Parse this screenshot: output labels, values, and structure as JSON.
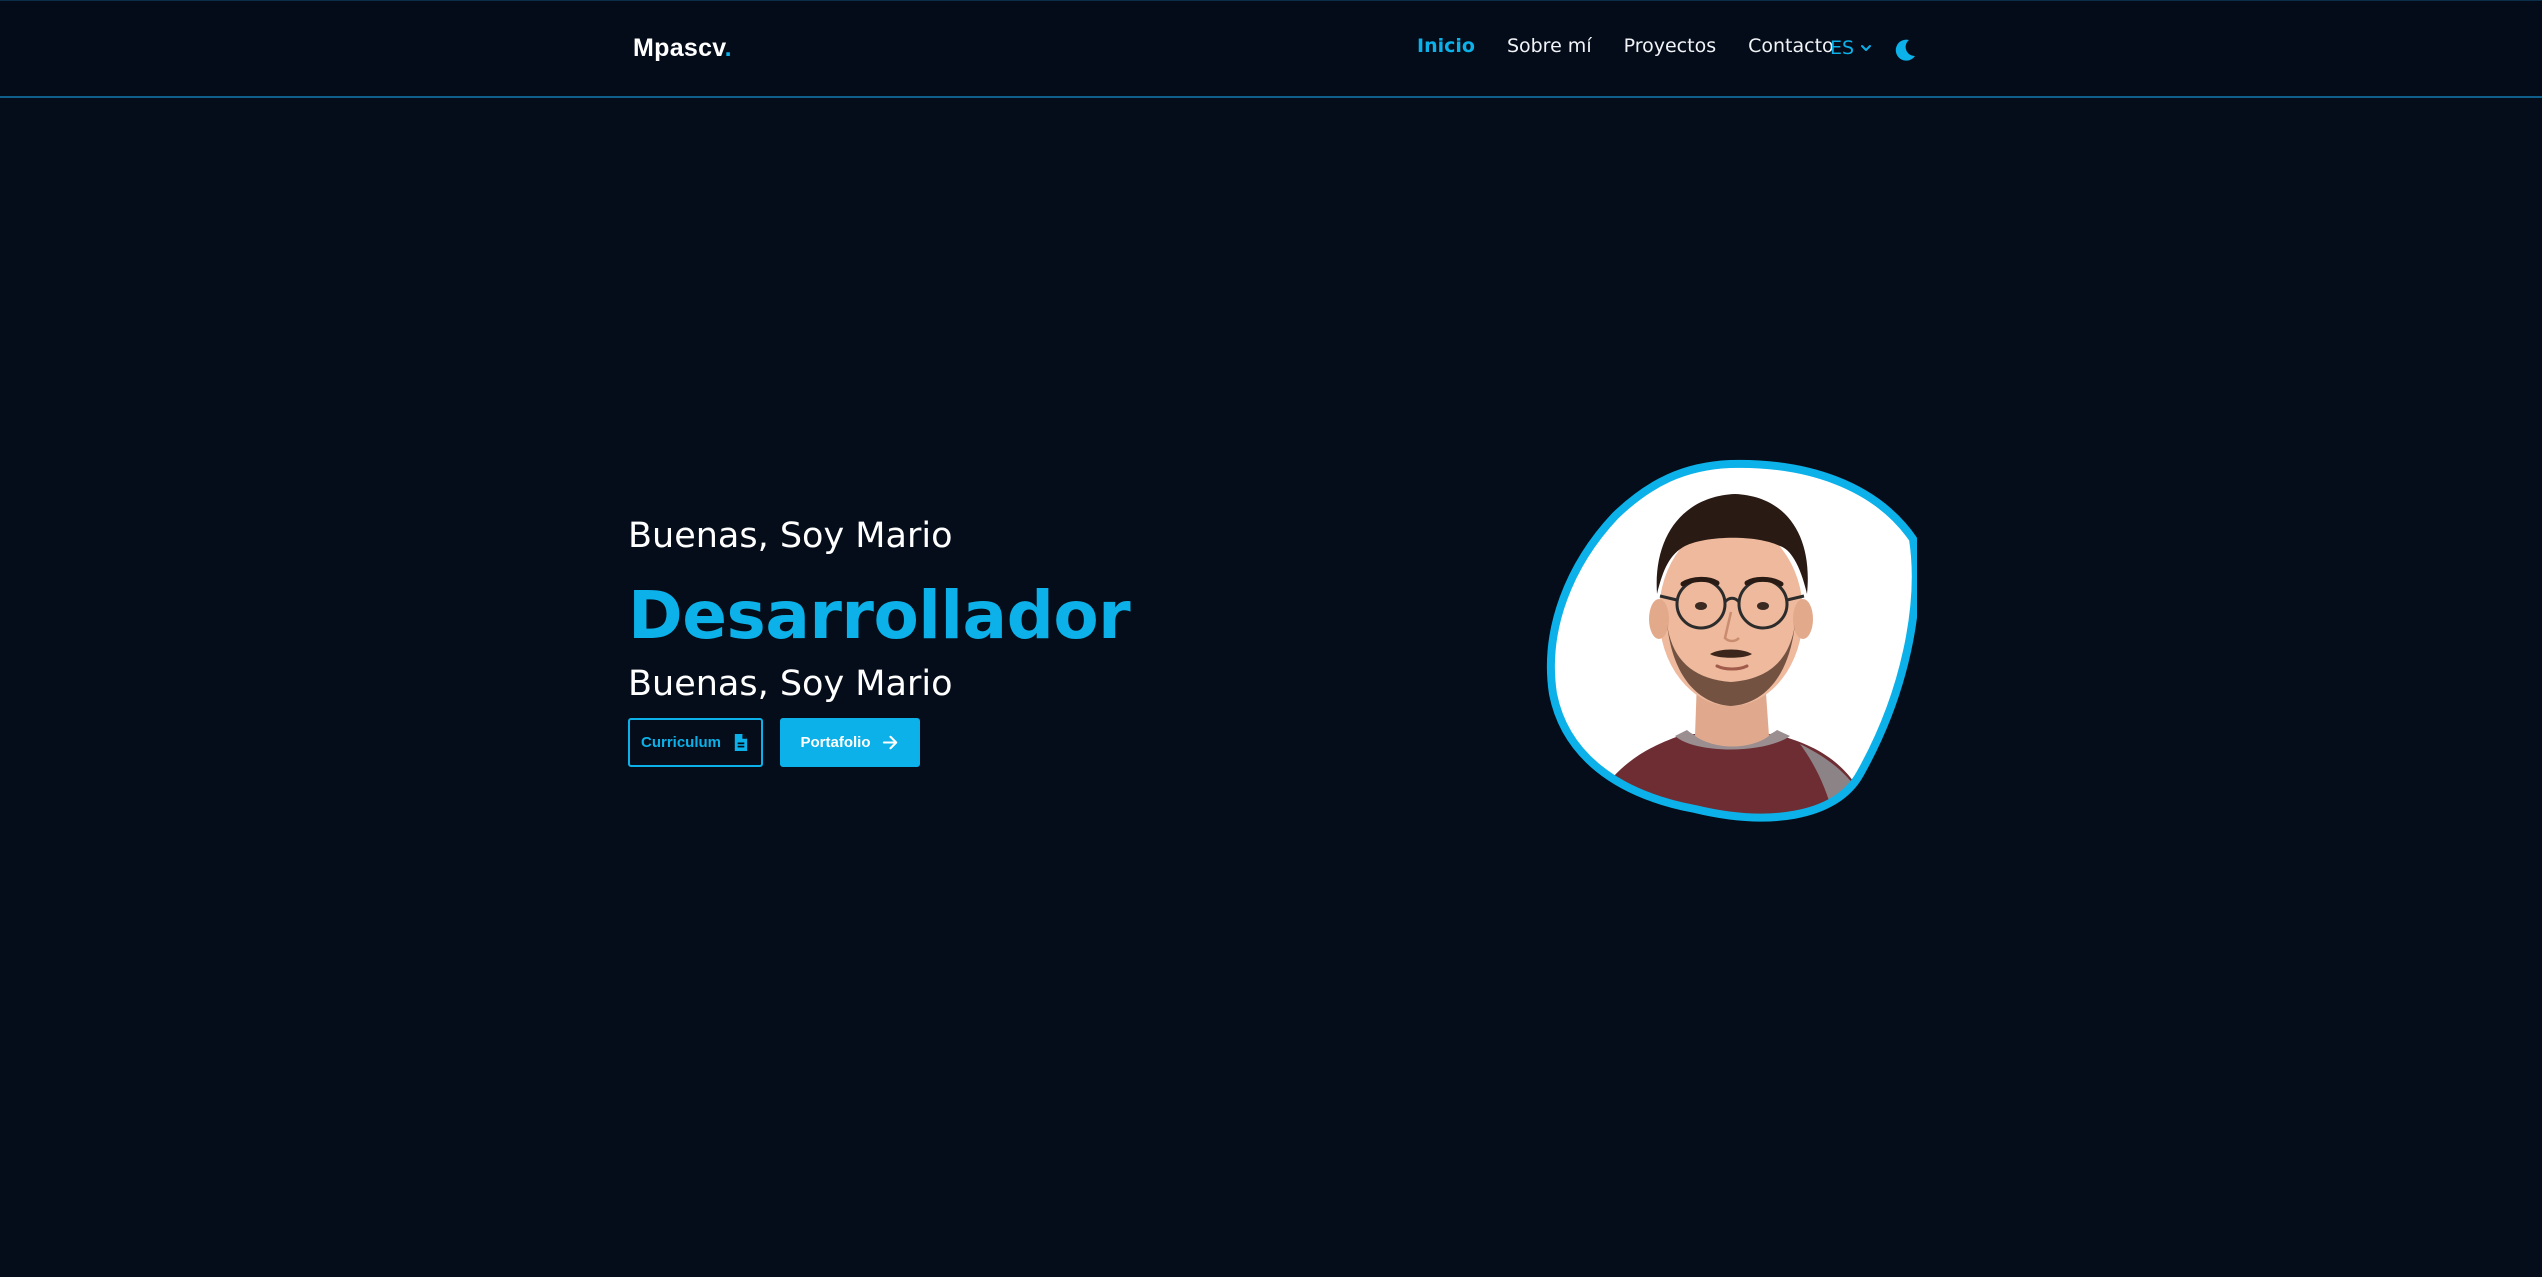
{
  "header": {
    "logo": {
      "text": "Mpascv",
      "dot": "."
    },
    "nav": [
      {
        "label": "Inicio",
        "active": true
      },
      {
        "label": "Sobre mí",
        "active": false
      },
      {
        "label": "Proyectos",
        "active": false
      },
      {
        "label": "Contacto",
        "active": false
      }
    ],
    "language": {
      "value": "ES",
      "icon": "chevron-down-icon"
    },
    "theme_toggle": {
      "icon": "moon-icon"
    }
  },
  "hero": {
    "greeting": "Buenas, Soy Mario",
    "role": "Desarrollador",
    "greeting_repeat": "Buenas, Soy Mario",
    "buttons": {
      "cv": {
        "label": "Curriculum",
        "icon": "document-icon"
      },
      "portfolio": {
        "label": "Portafolio",
        "icon": "arrow-right-icon"
      }
    },
    "avatar": {
      "icon": "profile-photo"
    }
  },
  "colors": {
    "background": "#050d1b",
    "accent": "#0bb1e8",
    "text": "#ffffff"
  }
}
